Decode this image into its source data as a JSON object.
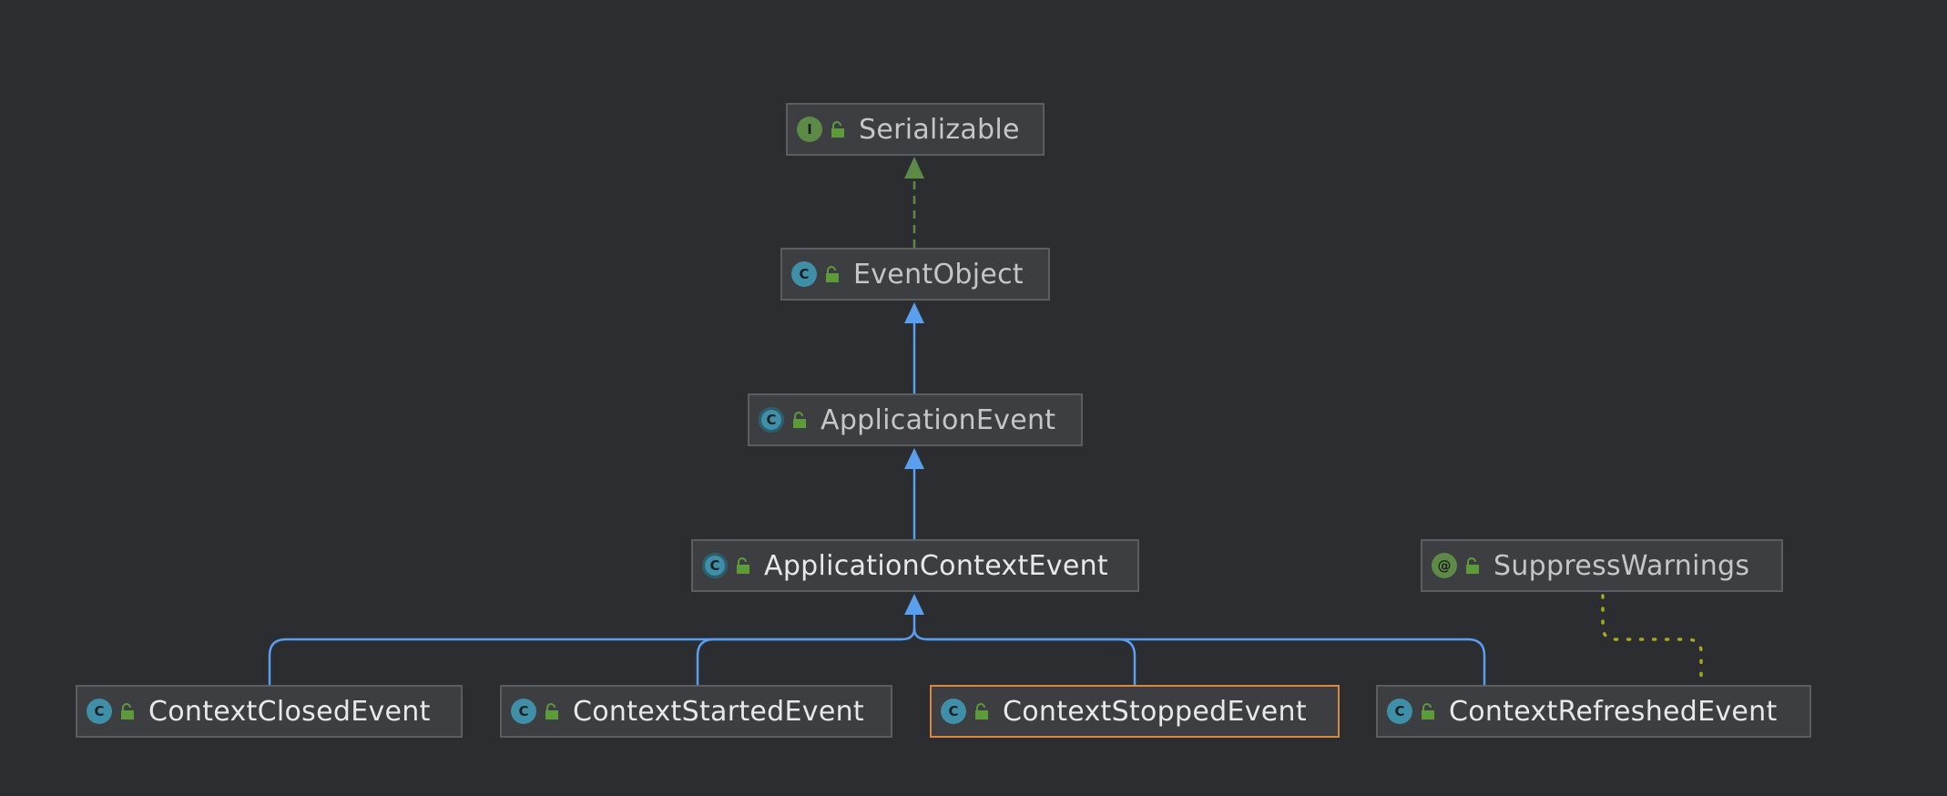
{
  "nodes": [
    {
      "id": "serializable",
      "label": "Serializable",
      "kind": "interface",
      "kind_letter": "I"
    },
    {
      "id": "eventobject",
      "label": "EventObject",
      "kind": "class",
      "kind_letter": "C"
    },
    {
      "id": "applicationevent",
      "label": "ApplicationEvent",
      "kind": "abstract",
      "kind_letter": "C"
    },
    {
      "id": "applicationcontextevent",
      "label": "ApplicationContextEvent",
      "kind": "abstract",
      "kind_letter": "C"
    },
    {
      "id": "suppresswarnings",
      "label": "SuppressWarnings",
      "kind": "annotation",
      "kind_letter": "@"
    },
    {
      "id": "contextclosedevent",
      "label": "ContextClosedEvent",
      "kind": "class",
      "kind_letter": "C"
    },
    {
      "id": "contextstartedevent",
      "label": "ContextStartedEvent",
      "kind": "class",
      "kind_letter": "C"
    },
    {
      "id": "contextstoppedevent",
      "label": "ContextStoppedEvent",
      "kind": "class",
      "kind_letter": "C",
      "selected": true
    },
    {
      "id": "contextrefreshedevent",
      "label": "ContextRefreshedEvent",
      "kind": "class",
      "kind_letter": "C"
    }
  ],
  "edges": [
    {
      "from": "eventobject",
      "to": "serializable",
      "type": "implements"
    },
    {
      "from": "applicationevent",
      "to": "eventobject",
      "type": "extends"
    },
    {
      "from": "applicationcontextevent",
      "to": "applicationevent",
      "type": "extends"
    },
    {
      "from": "contextclosedevent",
      "to": "applicationcontextevent",
      "type": "extends"
    },
    {
      "from": "contextstartedevent",
      "to": "applicationcontextevent",
      "type": "extends"
    },
    {
      "from": "contextstoppedevent",
      "to": "applicationcontextevent",
      "type": "extends"
    },
    {
      "from": "contextrefreshedevent",
      "to": "applicationcontextevent",
      "type": "extends"
    },
    {
      "from": "suppresswarnings",
      "to": "contextrefreshedevent",
      "type": "annotates"
    }
  ],
  "colors": {
    "background": "#2b2d30",
    "extends_edge": "#5a9ef0",
    "implements_edge": "#5d8a46",
    "annotation_edge": "#a5a81f",
    "selection": "#d9893f",
    "class_icon": "#3f8fa8",
    "interface_icon": "#5d8a46",
    "lock_icon": "#5d9b3a"
  }
}
